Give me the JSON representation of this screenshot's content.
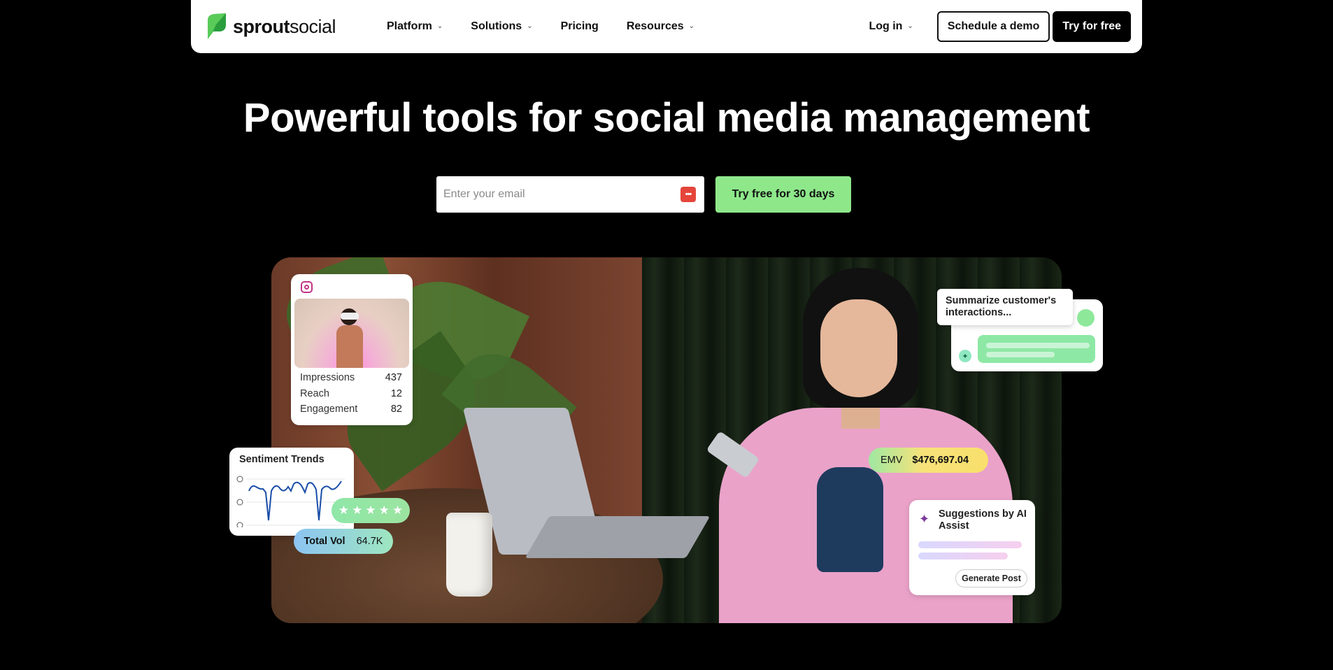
{
  "nav": {
    "logo_bold": "sprout",
    "logo_light": "social",
    "links": [
      {
        "label": "Platform",
        "chevron": true
      },
      {
        "label": "Solutions",
        "chevron": true
      },
      {
        "label": "Pricing",
        "chevron": false
      },
      {
        "label": "Resources",
        "chevron": true
      }
    ],
    "login_label": "Log in",
    "demo_label": "Schedule a demo",
    "try_label": "Try for free"
  },
  "hero": {
    "title": "Powerful tools for social media management",
    "email_placeholder": "Enter your email",
    "cta_label": "Try free for 30 days"
  },
  "cards": {
    "instagram": {
      "icon": "instagram-icon",
      "stats": [
        {
          "label": "Impressions",
          "value": "437"
        },
        {
          "label": "Reach",
          "value": "12"
        },
        {
          "label": "Engagement",
          "value": "82"
        }
      ]
    },
    "sentiment": {
      "title": "Sentiment Trends",
      "stars": 5,
      "total_label": "Total Vol",
      "total_value": "64.7K"
    },
    "ai_summary": {
      "prompt": "Summarize customer's interactions..."
    },
    "emv": {
      "label": "EMV",
      "value": "$476,697.04"
    },
    "suggestions": {
      "title": "Suggestions by AI Assist",
      "button": "Generate Post"
    }
  },
  "colors": {
    "brand_green": "#59cb59",
    "cta_green": "#8ee88a",
    "background": "#000000"
  }
}
